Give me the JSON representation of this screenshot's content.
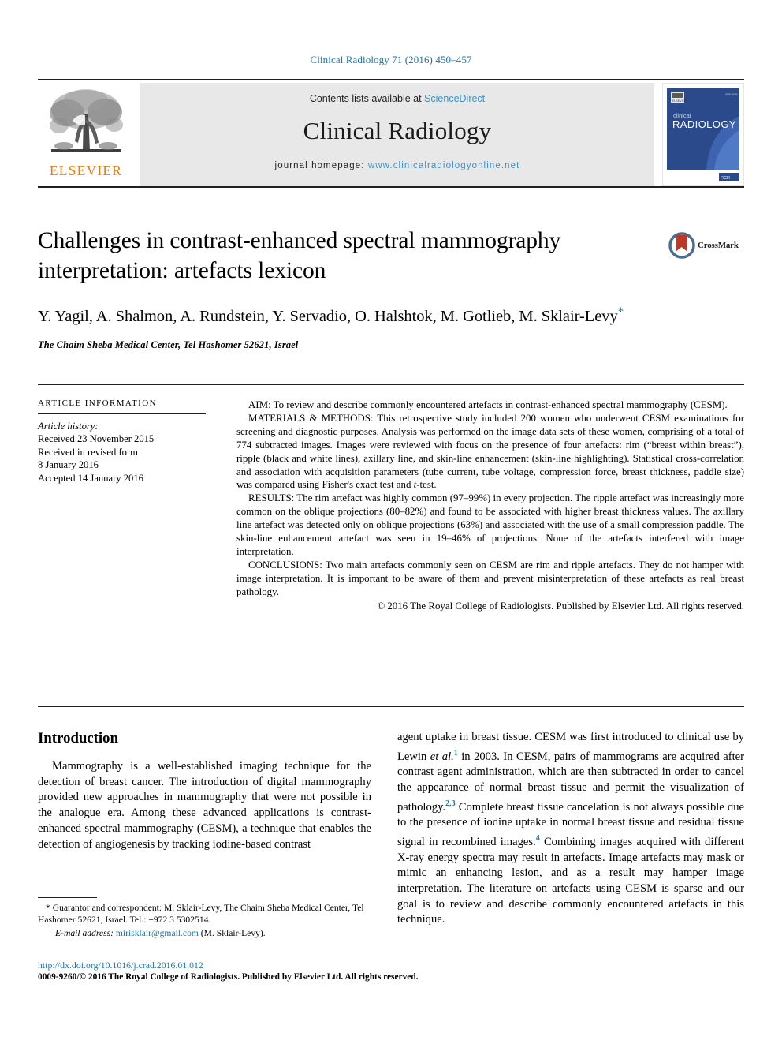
{
  "running_head": "Clinical Radiology 71 (2016) 450–457",
  "masthead": {
    "publisher_logo_label": "ELSEVIER",
    "contents_prefix": "Contents lists available at ",
    "contents_link": "ScienceDirect",
    "journal_title": "Clinical Radiology",
    "homepage_prefix": "journal homepage: ",
    "homepage_link": "www.clinicalradiologyonline.net",
    "cover": {
      "line1": "clinical",
      "line2": "RADIOLOGY"
    }
  },
  "crossmark": {
    "label": "CrossMark"
  },
  "article": {
    "title": "Challenges in contrast-enhanced spectral mammography interpretation: artefacts lexicon",
    "authors": "Y. Yagil, A. Shalmon, A. Rundstein, Y. Servadio, O. Halshtok, M. Gotlieb, M. Sklair-Levy",
    "corresponding_marker": "*",
    "affiliation": "The Chaim Sheba Medical Center, Tel Hashomer 52621, Israel"
  },
  "article_information": {
    "heading": "ARTICLE INFORMATION",
    "history_label": "Article history:",
    "received": "Received 23 November 2015",
    "revised_label": "Received in revised form",
    "revised_date": "8 January 2016",
    "accepted": "Accepted 14 January 2016"
  },
  "abstract": {
    "aim_label": "AIM:",
    "aim_text": " To review and describe commonly encountered artefacts in contrast-enhanced spectral mammography (CESM).",
    "methods_label": "MATERIALS & METHODS:",
    "methods_text_a": " This retrospective study included 200 women who underwent CESM examinations for screening and diagnostic purposes. Analysis was performed on the image data sets of these women, comprising of a total of 774 subtracted images. Images were reviewed with focus on the presence of four artefacts: rim (“breast within breast”), ripple (black and white lines), axillary line, and skin-line enhancement (skin-line highlighting). Statistical cross-correlation and association with acquisition parameters (tube current, tube voltage, compression force, breast thickness, paddle size) was compared using Fisher's exact test and ",
    "methods_italic": "t",
    "methods_text_b": "-test.",
    "results_label": "RESULTS:",
    "results_text": " The rim artefact was highly common (97–99%) in every projection. The ripple artefact was increasingly more common on the oblique projections (80–82%) and found to be associated with higher breast thickness values. The axillary line artefact was detected only on oblique projections (63%) and associated with the use of a small compression paddle. The skin-line enhancement artefact was seen in 19–46% of projections. None of the artefacts interfered with image interpretation.",
    "conclusions_label": "CONCLUSIONS:",
    "conclusions_text": " Two main artefacts commonly seen on CESM are rim and ripple artefacts. They do not hamper with image interpretation. It is important to be aware of them and prevent misinterpretation of these artefacts as real breast pathology.",
    "copyright": "© 2016 The Royal College of Radiologists. Published by Elsevier Ltd. All rights reserved."
  },
  "body": {
    "section_heading": "Introduction",
    "left_paragraph": "Mammography is a well-established imaging technique for the detection of breast cancer. The introduction of digital mammography provided new approaches in mammography that were not possible in the analogue era. Among these advanced applications is contrast-enhanced spectral mammography (CESM), a technique that enables the detection of angiogenesis by tracking iodine-based contrast",
    "right_part_1": "agent uptake in breast tissue. CESM was first introduced to clinical use by Lewin ",
    "right_italic_1": "et al.",
    "right_ref_1": "1",
    "right_part_2": " in 2003. In CESM, pairs of mammograms are acquired after contrast agent administration, which are then subtracted in order to cancel the appearance of normal breast tissue and permit the visualization of pathology.",
    "right_ref_2": "2,3",
    "right_part_3": " Complete breast tissue cancelation is not always possible due to the presence of iodine uptake in normal breast tissue and residual tissue signal in recombined images.",
    "right_ref_3": "4",
    "right_part_4": " Combining images acquired with different X-ray energy spectra may result in artefacts. Image artefacts may mask or mimic an enhancing lesion, and as a result may hamper image interpretation. The literature on artefacts using CESM is sparse and our goal is to review and describe commonly encountered artefacts in this technique."
  },
  "footnote": {
    "guarantor": "* Guarantor and correspondent: M. Sklair-Levy, The Chaim Sheba Medical Center, Tel Hashomer 52621, Israel. Tel.: +972 3 5302514.",
    "email_label": "E-mail address:",
    "email": "mirisklair@gmail.com",
    "email_attrib": " (M. Sklair-Levy)."
  },
  "footer": {
    "doi": "http://dx.doi.org/10.1016/j.crad.2016.01.012",
    "issn_copyright": "0009-9260/© 2016 The Royal College of Radiologists. Published by Elsevier Ltd. All rights reserved."
  },
  "colors": {
    "link_blue": "#1b75ad",
    "sciencedirect_blue": "#3c93c6",
    "elsevier_orange": "#f07c00",
    "cover_blue": "#2a4a8b",
    "crossmark_red": "#c0392b"
  }
}
